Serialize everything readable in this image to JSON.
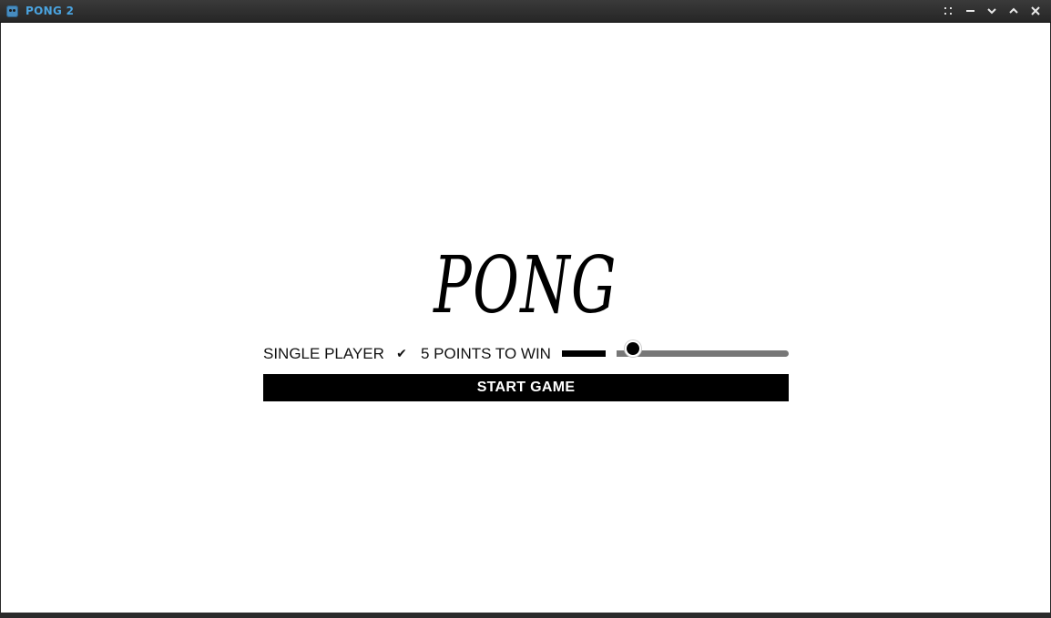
{
  "window": {
    "title": "PONG 2",
    "icon": "godot-icon",
    "controls": [
      {
        "name": "menu-dots-icon",
        "glyph": ""
      },
      {
        "name": "minimize-icon",
        "glyph": ""
      },
      {
        "name": "chevron-down-icon",
        "glyph": "⌄"
      },
      {
        "name": "chevron-up-icon",
        "glyph": "⌃"
      },
      {
        "name": "close-icon",
        "glyph": "✕"
      }
    ]
  },
  "menu": {
    "title": "PONG",
    "single_player": {
      "label": "SINGLE PLAYER",
      "checked": true,
      "check_glyph": "✔"
    },
    "points_to_win": {
      "label": "5 POINTS TO WIN",
      "value_fraction": 0.31
    },
    "start_button": "START GAME"
  },
  "colors": {
    "title_text": "#4aa3df",
    "background": "#ffffff",
    "button": "#000000",
    "track": "#777777"
  }
}
